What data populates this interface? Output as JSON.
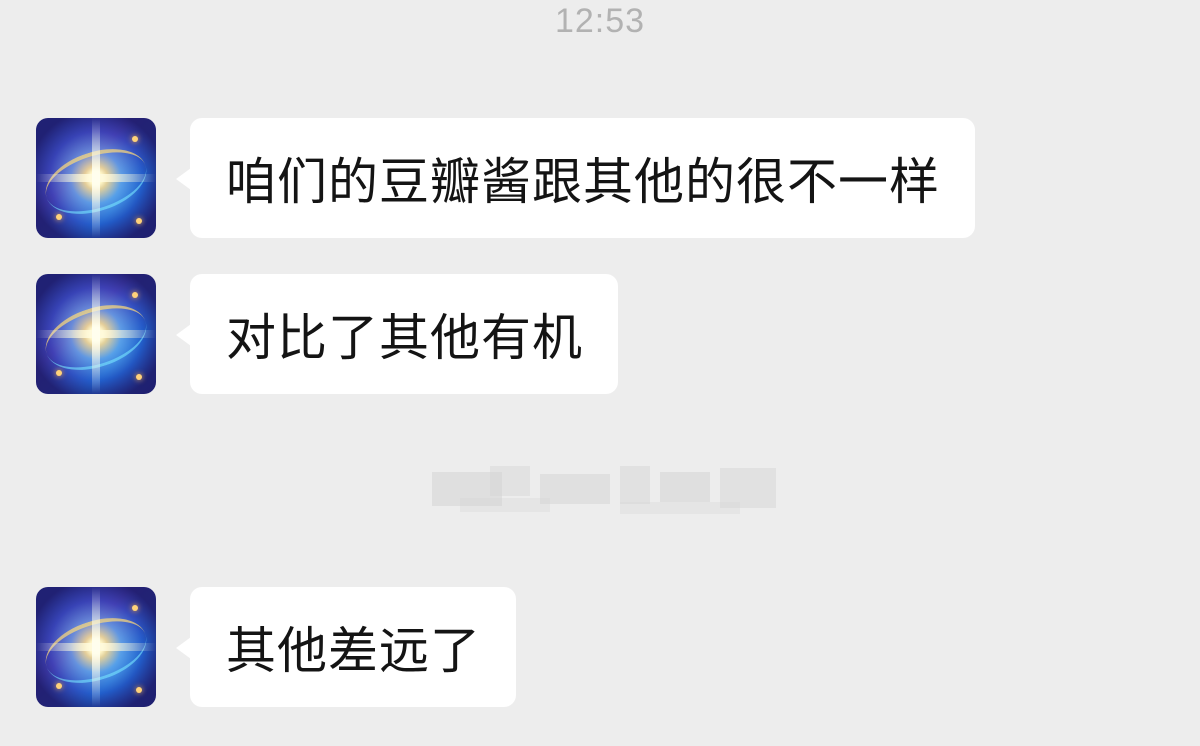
{
  "chat": {
    "timestamp": "12:53",
    "messages": [
      {
        "sender_avatar": "light-burst-avatar",
        "text": "咱们的豆瓣酱跟其他的很不一样"
      },
      {
        "sender_avatar": "light-burst-avatar",
        "text": "对比了其他有机"
      },
      {
        "sender_avatar": "light-burst-avatar",
        "text": "其他差远了"
      }
    ]
  },
  "colors": {
    "background": "#ededed",
    "bubble": "#ffffff",
    "text": "#141414",
    "timestamp": "#b2b2b2"
  }
}
